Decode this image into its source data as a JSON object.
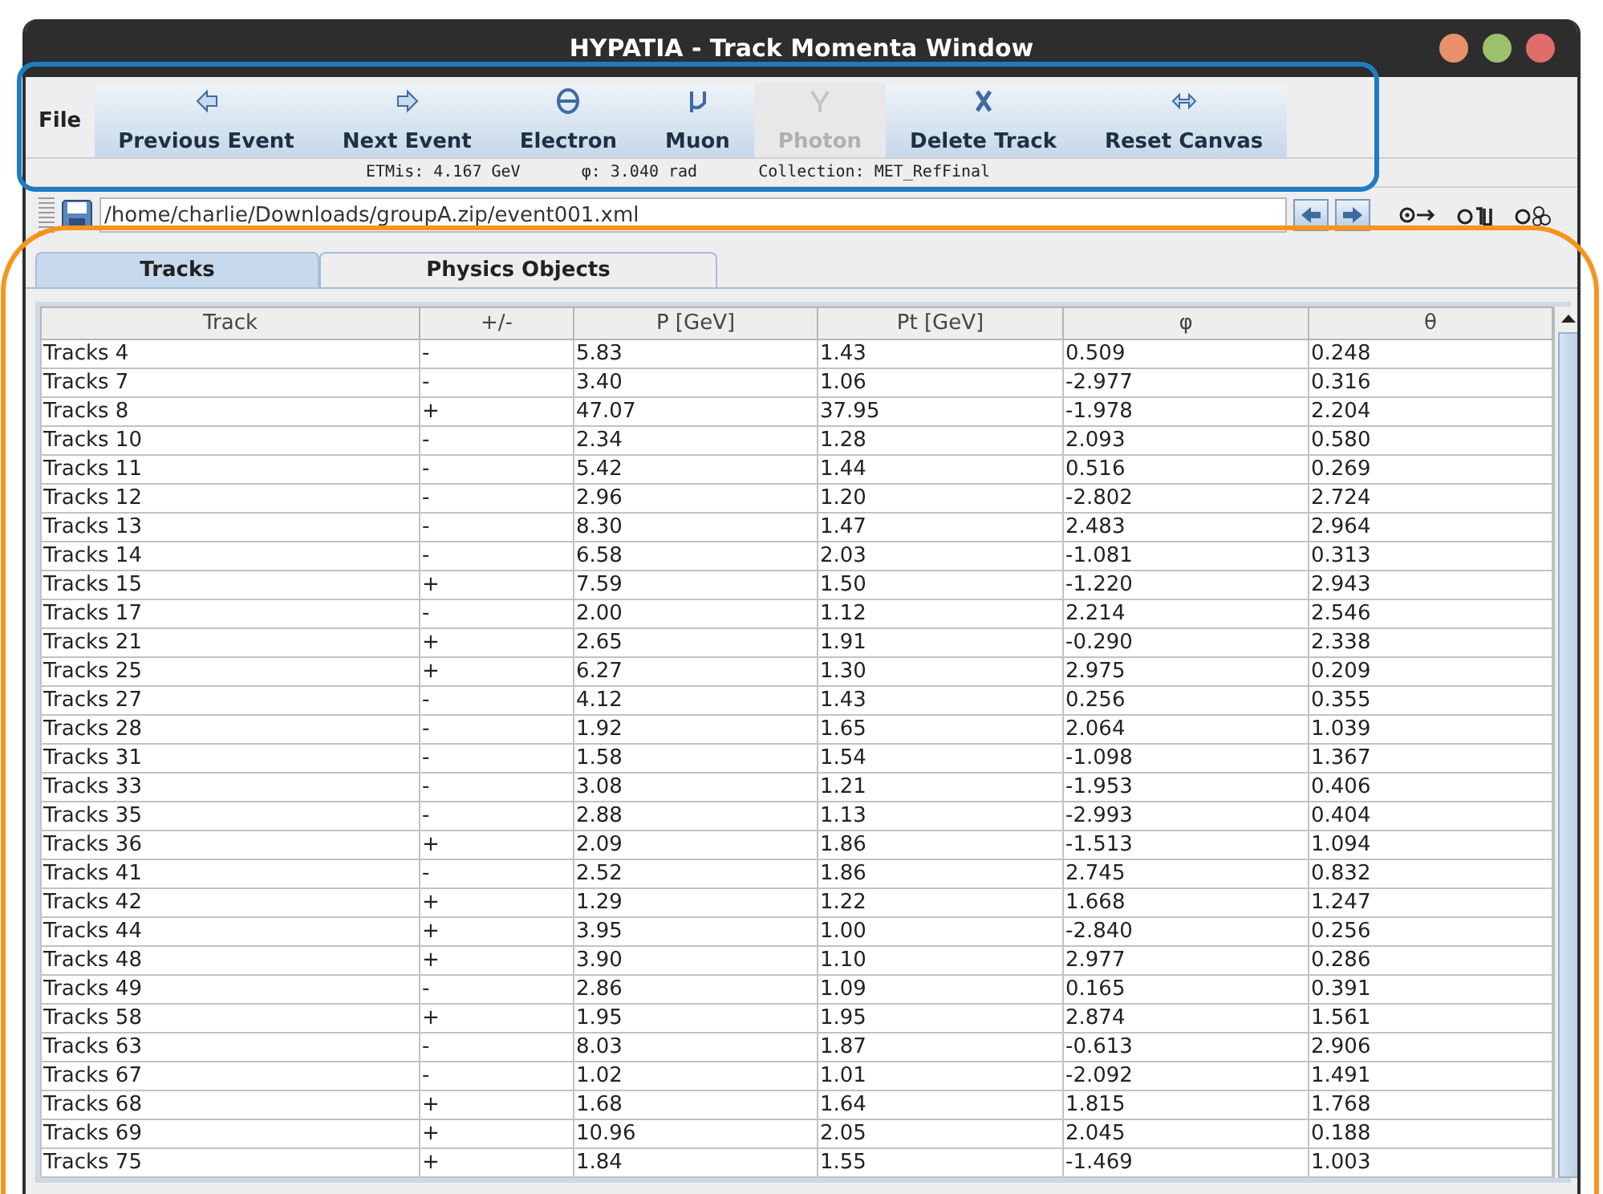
{
  "window": {
    "title": "HYPATIA - Track Momenta Window"
  },
  "menu": [
    "File"
  ],
  "toolbar": [
    {
      "label": "Previous Event",
      "kind": "left",
      "disabled": false
    },
    {
      "label": "Next Event",
      "kind": "right",
      "disabled": false
    },
    {
      "label": "Electron",
      "kind": "electron",
      "disabled": false
    },
    {
      "label": "Muon",
      "kind": "muon",
      "disabled": false
    },
    {
      "label": "Photon",
      "kind": "photon",
      "disabled": true
    },
    {
      "label": "Delete Track",
      "kind": "delete",
      "disabled": false
    },
    {
      "label": "Reset Canvas",
      "kind": "reset",
      "disabled": false
    }
  ],
  "status": [
    "ETMis: 4.167 GeV",
    "φ: 3.040 rad",
    "Collection: MET_RefFinal"
  ],
  "path": {
    "value": "/home/charlie/Downloads/groupA.zip/event001.xml"
  },
  "tabs": [
    {
      "label": "Tracks",
      "selected": true
    },
    {
      "label": "Physics Objects",
      "selected": false
    }
  ],
  "table": {
    "columns": [
      "Track",
      "+/-",
      "P [GeV]",
      "Pt [GeV]",
      "φ",
      "θ"
    ],
    "rows": [
      [
        "Tracks 4",
        "-",
        "5.83",
        "1.43",
        "0.509",
        "0.248"
      ],
      [
        "Tracks 7",
        "-",
        "3.40",
        "1.06",
        "-2.977",
        "0.316"
      ],
      [
        "Tracks 8",
        "+",
        "47.07",
        "37.95",
        "-1.978",
        "2.204"
      ],
      [
        "Tracks 10",
        "-",
        "2.34",
        "1.28",
        "2.093",
        "0.580"
      ],
      [
        "Tracks 11",
        "-",
        "5.42",
        "1.44",
        "0.516",
        "0.269"
      ],
      [
        "Tracks 12",
        "-",
        "2.96",
        "1.20",
        "-2.802",
        "2.724"
      ],
      [
        "Tracks 13",
        "-",
        "8.30",
        "1.47",
        "2.483",
        "2.964"
      ],
      [
        "Tracks 14",
        "-",
        "6.58",
        "2.03",
        "-1.081",
        "0.313"
      ],
      [
        "Tracks 15",
        "+",
        "7.59",
        "1.50",
        "-1.220",
        "2.943"
      ],
      [
        "Tracks 17",
        "-",
        "2.00",
        "1.12",
        "2.214",
        "2.546"
      ],
      [
        "Tracks 21",
        "+",
        "2.65",
        "1.91",
        "-0.290",
        "2.338"
      ],
      [
        "Tracks 25",
        "+",
        "6.27",
        "1.30",
        "2.975",
        "0.209"
      ],
      [
        "Tracks 27",
        "-",
        "4.12",
        "1.43",
        "0.256",
        "0.355"
      ],
      [
        "Tracks 28",
        "-",
        "1.92",
        "1.65",
        "2.064",
        "1.039"
      ],
      [
        "Tracks 31",
        "-",
        "1.58",
        "1.54",
        "-1.098",
        "1.367"
      ],
      [
        "Tracks 33",
        "-",
        "3.08",
        "1.21",
        "-1.953",
        "0.406"
      ],
      [
        "Tracks 35",
        "-",
        "2.88",
        "1.13",
        "-2.993",
        "0.404"
      ],
      [
        "Tracks 36",
        "+",
        "2.09",
        "1.86",
        "-1.513",
        "1.094"
      ],
      [
        "Tracks 41",
        "-",
        "2.52",
        "1.86",
        "2.745",
        "0.832"
      ],
      [
        "Tracks 42",
        "+",
        "1.29",
        "1.22",
        "1.668",
        "1.247"
      ],
      [
        "Tracks 44",
        "+",
        "3.95",
        "1.00",
        "-2.840",
        "0.256"
      ],
      [
        "Tracks 48",
        "+",
        "3.90",
        "1.10",
        "2.977",
        "0.286"
      ],
      [
        "Tracks 49",
        "-",
        "2.86",
        "1.09",
        "0.165",
        "0.391"
      ],
      [
        "Tracks 58",
        "+",
        "1.95",
        "1.95",
        "2.874",
        "1.561"
      ],
      [
        "Tracks 63",
        "-",
        "8.03",
        "1.87",
        "-0.613",
        "2.906"
      ],
      [
        "Tracks 67",
        "-",
        "1.02",
        "1.01",
        "-2.092",
        "1.491"
      ],
      [
        "Tracks 68",
        "+",
        "1.68",
        "1.64",
        "1.815",
        "1.768"
      ],
      [
        "Tracks 69",
        "+",
        "10.96",
        "2.05",
        "2.045",
        "0.188"
      ],
      [
        "Tracks 75",
        "+",
        "1.84",
        "1.55",
        "-1.469",
        "1.003"
      ]
    ]
  }
}
